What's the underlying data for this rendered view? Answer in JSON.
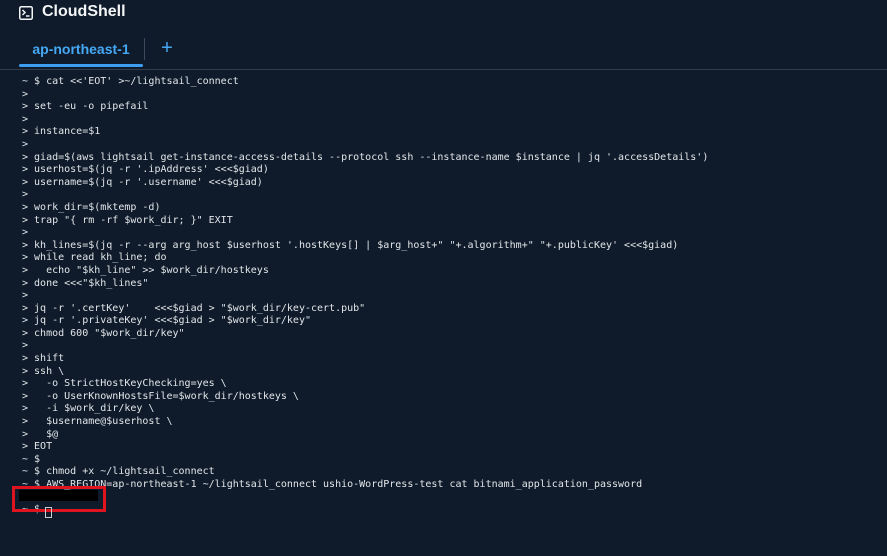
{
  "app": {
    "title": "CloudShell",
    "icon": "terminal-prompt-icon"
  },
  "tabs": [
    {
      "label": "ap-northeast-1",
      "active": true
    }
  ],
  "add_tab_label": "+",
  "colors": {
    "background": "#0f1b2a",
    "accent": "#46a8f5",
    "terminal_text": "#e2e6ea",
    "highlight_box": "#e0141e"
  },
  "terminal": {
    "lines": [
      "~ $ cat <<'EOT' >~/lightsail_connect",
      ">",
      "> set -eu -o pipefail",
      ">",
      "> instance=$1",
      ">",
      "> giad=$(aws lightsail get-instance-access-details --protocol ssh --instance-name $instance | jq '.accessDetails')",
      "> userhost=$(jq -r '.ipAddress' <<<$giad)",
      "> username=$(jq -r '.username' <<<$giad)",
      ">",
      "> work_dir=$(mktemp -d)",
      "> trap \"{ rm -rf $work_dir; }\" EXIT",
      ">",
      "> kh_lines=$(jq -r --arg arg_host $userhost '.hostKeys[] | $arg_host+\" \"+.algorithm+\" \"+.publicKey' <<<$giad)",
      "> while read kh_line; do",
      ">   echo \"$kh_line\" >> $work_dir/hostkeys",
      "> done <<<\"$kh_lines\"",
      ">",
      "> jq -r '.certKey'    <<<$giad > \"$work_dir/key-cert.pub\"",
      "> jq -r '.privateKey' <<<$giad > \"$work_dir/key\"",
      "> chmod 600 \"$work_dir/key\"",
      ">",
      "> shift",
      "> ssh \\",
      ">   -o StrictHostKeyChecking=yes \\",
      ">   -o UserKnownHostsFile=$work_dir/hostkeys \\",
      ">   -i $work_dir/key \\",
      ">   $username@$userhost \\",
      ">   $@",
      "> EOT",
      "~ $",
      "~ $ chmod +x ~/lightsail_connect",
      "~ $ AWS_REGION=ap-northeast-1 ~/lightsail_connect ushio-WordPress-test cat bitnami_application_password",
      "",
      "~ $ "
    ]
  }
}
